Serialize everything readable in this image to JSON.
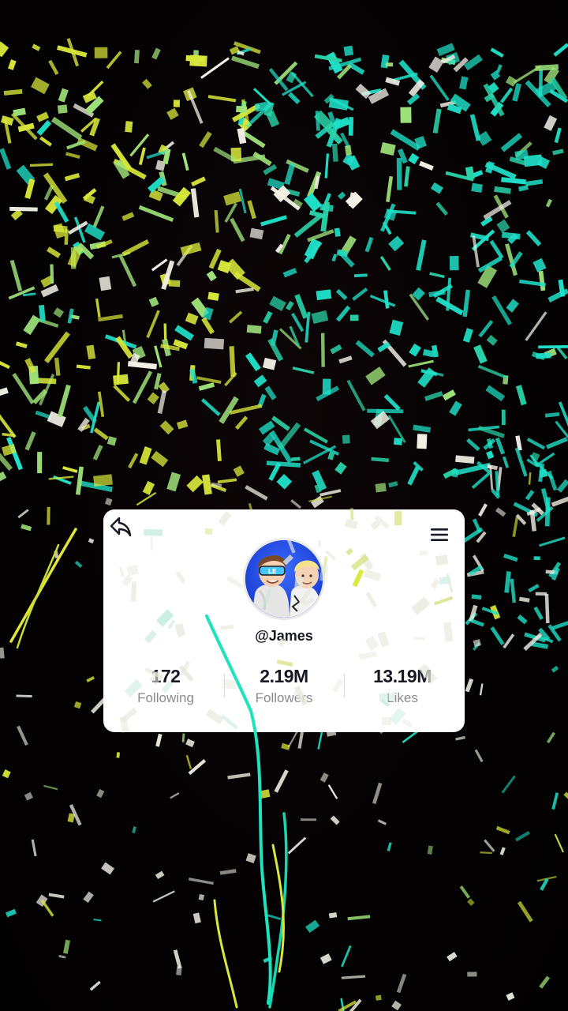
{
  "profile": {
    "username": "@James",
    "avatar_icon": "cartoon-friends-avatar-icon",
    "back_icon": "share-back-arrow-icon",
    "menu_icon": "hamburger-menu-icon"
  },
  "stats": [
    {
      "value": "172",
      "label": "Following"
    },
    {
      "value": "2.19M",
      "label": "Followers"
    },
    {
      "value": "13.19M",
      "label": "Likes"
    }
  ],
  "theme": {
    "background": "#050203",
    "card": "#ffffff",
    "confetti_colors": [
      "#1fe0c8",
      "#d8e83a",
      "#9fe37a",
      "#f3f0e6",
      "#2ad3a8"
    ]
  }
}
